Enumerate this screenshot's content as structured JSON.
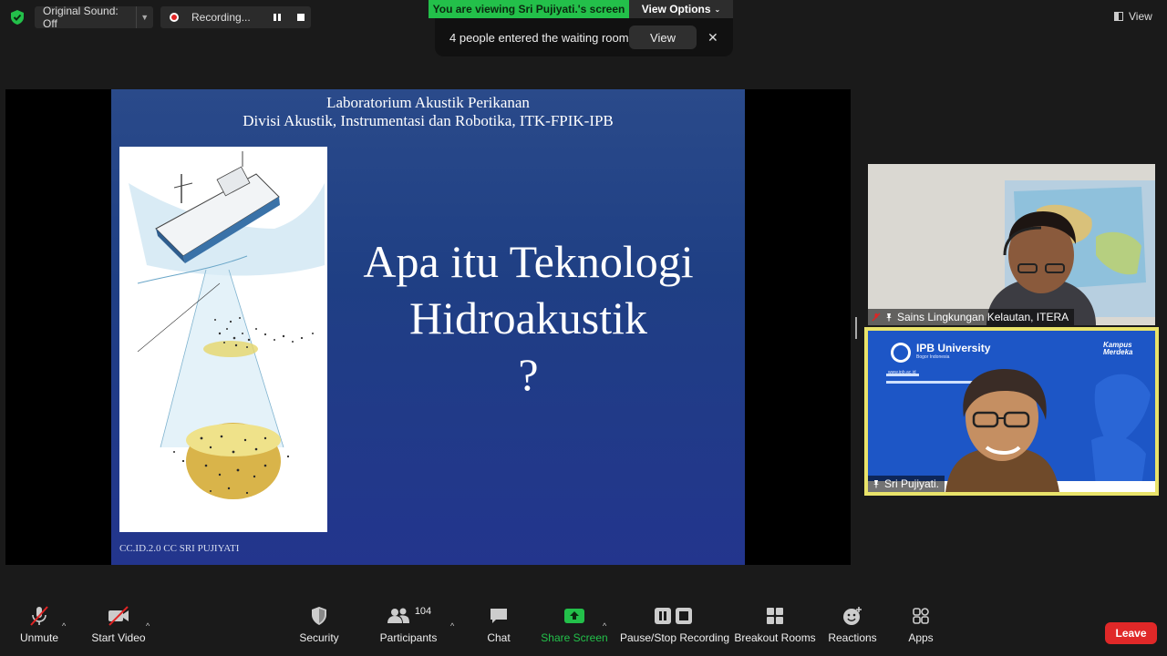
{
  "top_bar": {
    "original_sound": "Original Sound: Off",
    "recording": "Recording...",
    "viewing_banner": "You are viewing Sri Pujiyati.'s screen",
    "view_options": "View Options",
    "waiting_room_text": "4 people entered the waiting room",
    "waiting_room_button": "View",
    "view_label": "View",
    "colors": {
      "banner_green": "#23c04a",
      "record_red": "#e02424"
    }
  },
  "slide": {
    "header_line1": "Laboratorium Akustik Perikanan",
    "header_line2": "Divisi Akustik, Instrumentasi dan Robotika, ITK-FPIK-IPB",
    "title_line1": "Apa itu Teknologi",
    "title_line2": "Hidroakustik",
    "title_line3": "?",
    "footer": "CC.ID.2.0 CC SRI PUJIYATI"
  },
  "participants": [
    {
      "name": "Sains Lingkungan Kelautan, ITERA",
      "muted": true
    },
    {
      "name": "Sri Pujiyati.",
      "active_speaker": true,
      "backdrop_brand": "IPB University",
      "backdrop_sub": "Bogor Indonesia",
      "backdrop_tag": "Kampus Merdeka",
      "backdrop_url": "www.ipb.ac.id"
    }
  ],
  "toolbar": {
    "unmute": "Unmute",
    "start_video": "Start Video",
    "security": "Security",
    "participants": "Participants",
    "participants_count": "104",
    "chat": "Chat",
    "share_screen": "Share Screen",
    "pause_stop_recording": "Pause/Stop Recording",
    "breakout_rooms": "Breakout Rooms",
    "reactions": "Reactions",
    "apps": "Apps",
    "leave": "Leave",
    "colors": {
      "share_green": "#23c04a",
      "leave_red": "#e02828"
    }
  }
}
